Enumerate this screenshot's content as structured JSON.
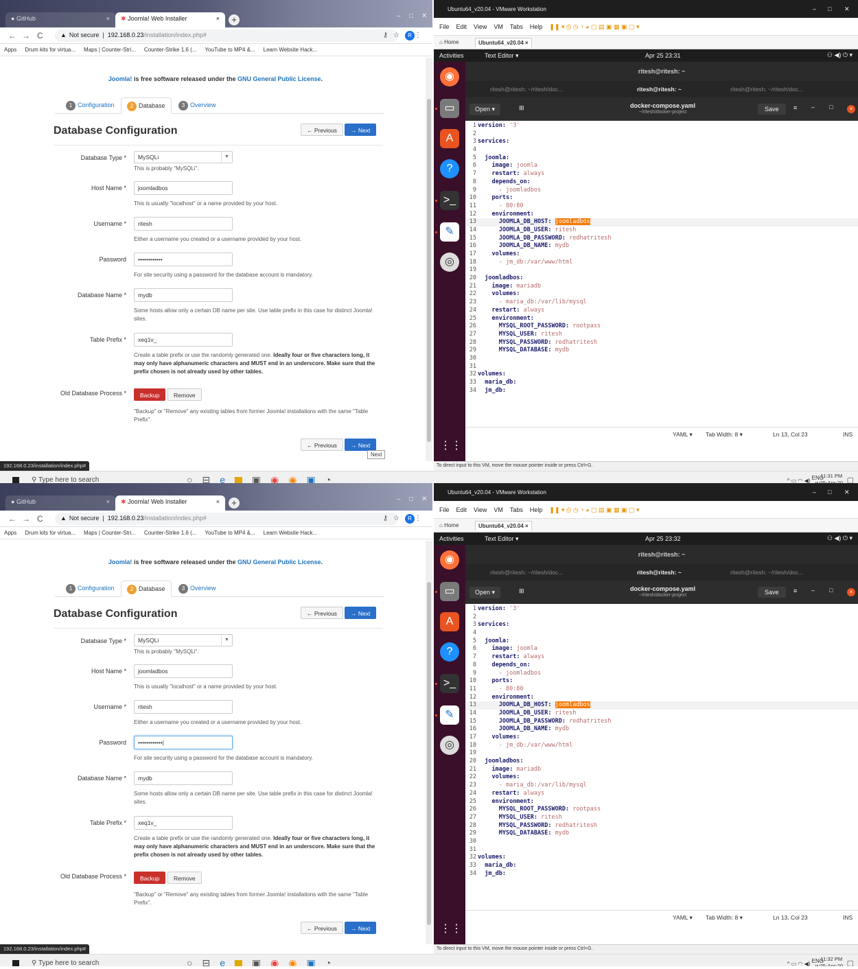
{
  "shots": [
    {
      "browser": {
        "tabs": [
          "GitHub",
          "Joomla! Web Installer"
        ],
        "security": "Not secure",
        "url_host": "192.168.0.23",
        "url_path": "/installation/index.php#",
        "bookmarks": [
          "Apps",
          "Drum kits for virtua...",
          "Maps | Counter-Stri...",
          "Counter-Strike 1.6 (...",
          "YouTube to MP4 &...",
          "Learn Website Hack..."
        ],
        "profile_initial": "R",
        "status_url": "192.168.0.23/installation/index.php#",
        "tooltip": "Next"
      },
      "joomla": {
        "license_pre": "Joomla!",
        "license_mid": " is free software released under the ",
        "license_link": "GNU General Public License",
        "license_end": ".",
        "steps": [
          {
            "n": "1",
            "label": "Configuration"
          },
          {
            "n": "2",
            "label": "Database"
          },
          {
            "n": "3",
            "label": "Overview"
          }
        ],
        "heading": "Database Configuration",
        "previous": "← Previous",
        "next": "→ Next",
        "labels": {
          "db_type": "Database Type *",
          "host": "Host Name *",
          "user": "Username *",
          "password": "Password",
          "db_name": "Database Name *",
          "prefix": "Table Prefix *",
          "old_db": "Old Database Process *"
        },
        "values": {
          "db_type": "MySQLi",
          "host": "joomladbos",
          "user": "ritesh",
          "password": "••••••••••••",
          "db_name": "mydb",
          "prefix": "xeq1v_"
        },
        "help": {
          "db_type": "This is probably \"MySQLi\".",
          "host": "This is usually \"localhost\" or a name provided by your host.",
          "user": "Either a username you created or a username provided by your host.",
          "password": "For site security using a password for the database account is mandatory.",
          "db_name": "Some hosts allow only a certain DB name per site. Use table prefix in this case for distinct Joomla! sites.",
          "prefix_a": "Create a table prefix or use the randomly generated one. ",
          "prefix_b": "Ideally four or five characters long, it may only have alphanumeric characters and MUST end in an underscore. Make sure that the prefix chosen is not already used by other tables.",
          "old_db": "\"Backup\" or \"Remove\" any existing tables from former Joomla! installations with the same \"Table Prefix\"."
        },
        "backup": "Backup",
        "remove": "Remove"
      },
      "taskbar": {
        "search": "Type here to search",
        "lang": "ENG",
        "lang2": "IN",
        "time": "11:31 PM",
        "date": "25-Apr-20"
      },
      "vm": {
        "title": "Ubuntu64_v20.04 - VMware Workstation",
        "menu": [
          "File",
          "Edit",
          "View",
          "VM",
          "Tabs",
          "Help"
        ],
        "tabs": [
          "Home",
          "Ubuntu64_v20.04"
        ],
        "activities": "Activities",
        "app": "Text Editor ▾",
        "clock": "Apr 25 23:31",
        "term_title": "ritesh@ritesh: ~",
        "term_tabs": [
          "ritesh@ritesh: ~/ritesh/doc...",
          "ritesh@ritesh: ~",
          "ritesh@ritesh: ~/ritesh/doc..."
        ],
        "open": "Open",
        "filename": "docker-compose.yaml",
        "filepath": "~/ritesh/docker-project",
        "save": "Save",
        "status_lang": "YAML ▾",
        "status_tab": "Tab Width: 8 ▾",
        "status_pos": "Ln 13, Col 23",
        "status_ins": "INS",
        "footer": "To direct input to this VM, move the mouse pointer inside or press Ctrl+G."
      }
    },
    {
      "browser": {
        "tabs": [
          "GitHub",
          "Joomla! Web Installer"
        ],
        "security": "Not secure",
        "url_host": "192.168.0.23",
        "url_path": "/installation/index.php#",
        "bookmarks": [
          "Apps",
          "Drum kits for virtua...",
          "Maps | Counter-Stri...",
          "Counter-Strike 1.6 (...",
          "YouTube to MP4 &...",
          "Learn Website Hack..."
        ],
        "profile_initial": "R",
        "status_url": "192.168.0.23/installation/index.php#",
        "tooltip": ""
      },
      "joomla": {
        "license_pre": "Joomla!",
        "license_mid": " is free software released under the ",
        "license_link": "GNU General Public License",
        "license_end": ".",
        "steps": [
          {
            "n": "1",
            "label": "Configuration"
          },
          {
            "n": "2",
            "label": "Database"
          },
          {
            "n": "3",
            "label": "Overview"
          }
        ],
        "heading": "Database Configuration",
        "previous": "← Previous",
        "next": "→ Next",
        "labels": {
          "db_type": "Database Type *",
          "host": "Host Name *",
          "user": "Username *",
          "password": "Password",
          "db_name": "Database Name *",
          "prefix": "Table Prefix *",
          "old_db": "Old Database Process *"
        },
        "values": {
          "db_type": "MySQLi",
          "host": "joomladbos",
          "user": "ritesh",
          "password": "••••••••••••|",
          "db_name": "mydb",
          "prefix": "xeq1v_"
        },
        "help": {
          "db_type": "This is probably \"MySQLi\".",
          "host": "This is usually \"localhost\" or a name provided by your host.",
          "user": "Either a username you created or a username provided by your host.",
          "password": "For site security using a password for the database account is mandatory.",
          "db_name": "Some hosts allow only a certain DB name per site. Use table prefix in this case for distinct Joomla! sites.",
          "prefix_a": "Create a table prefix or use the randomly generated one. ",
          "prefix_b": "Ideally four or five characters long, it may only have alphanumeric characters and MUST end in an underscore. Make sure that the prefix chosen is not already used by other tables.",
          "old_db": "\"Backup\" or \"Remove\" any existing tables from former Joomla! installations with the same \"Table Prefix\"."
        },
        "backup": "Backup",
        "remove": "Remove"
      },
      "taskbar": {
        "search": "Type here to search",
        "lang": "ENG",
        "lang2": "IN",
        "time": "11:32 PM",
        "date": "25-Apr-20"
      },
      "vm": {
        "title": "Ubuntu64_v20.04 - VMware Workstation",
        "menu": [
          "File",
          "Edit",
          "View",
          "VM",
          "Tabs",
          "Help"
        ],
        "tabs": [
          "Home",
          "Ubuntu64_v20.04"
        ],
        "activities": "Activities",
        "app": "Text Editor ▾",
        "clock": "Apr 25 23:32",
        "term_title": "ritesh@ritesh: ~",
        "term_tabs": [
          "ritesh@ritesh: ~/ritesh/doc...",
          "ritesh@ritesh: ~",
          "ritesh@ritesh: ~/ritesh/doc..."
        ],
        "open": "Open",
        "filename": "docker-compose.yaml",
        "filepath": "~/ritesh/docker-project",
        "save": "Save",
        "status_lang": "YAML ▾",
        "status_tab": "Tab Width: 8 ▾",
        "status_pos": "Ln 13, Col 23",
        "status_ins": "INS",
        "footer": "To direct input to this VM, move the mouse pointer inside or press Ctrl+G."
      }
    }
  ],
  "code_lines": [
    {
      "n": "1",
      "key": "version:",
      "val": " '3'",
      "indent": ""
    },
    {
      "n": "2",
      "key": "",
      "val": "",
      "indent": ""
    },
    {
      "n": "3",
      "key": "services:",
      "val": "",
      "indent": ""
    },
    {
      "n": "4",
      "key": "",
      "val": "",
      "indent": ""
    },
    {
      "n": "5",
      "key": "joomla:",
      "val": "",
      "indent": "  "
    },
    {
      "n": "6",
      "key": "image:",
      "val": " joomla",
      "indent": "    "
    },
    {
      "n": "7",
      "key": "restart:",
      "val": " always",
      "indent": "    "
    },
    {
      "n": "8",
      "key": "depends_on:",
      "val": "",
      "indent": "    "
    },
    {
      "n": "9",
      "key": "",
      "val": "- joomladbos",
      "indent": "      "
    },
    {
      "n": "10",
      "key": "ports:",
      "val": "",
      "indent": "    "
    },
    {
      "n": "11",
      "key": "",
      "val": "- 80:80",
      "indent": "      "
    },
    {
      "n": "12",
      "key": "environment:",
      "val": "",
      "indent": "    "
    },
    {
      "n": "13",
      "key": "JOOMLA_DB_HOST:",
      "val": "",
      "hl": "joomladbos",
      "indent": "      "
    },
    {
      "n": "14",
      "key": "JOOMLA_DB_USER:",
      "val": " ritesh",
      "indent": "      "
    },
    {
      "n": "15",
      "key": "JOOMLA_DB_PASSWORD:",
      "val": " redhatritesh",
      "indent": "      "
    },
    {
      "n": "16",
      "key": "JOOMLA_DB_NAME:",
      "val": " mydb",
      "indent": "      "
    },
    {
      "n": "17",
      "key": "volumes:",
      "val": "",
      "indent": "    "
    },
    {
      "n": "18",
      "key": "",
      "val": "- jm_db:/var/www/html",
      "indent": "      "
    },
    {
      "n": "19",
      "key": "",
      "val": "",
      "indent": ""
    },
    {
      "n": "20",
      "key": "joomladbos:",
      "val": "",
      "indent": "  "
    },
    {
      "n": "21",
      "key": "image:",
      "val": " mariadb",
      "indent": "    "
    },
    {
      "n": "22",
      "key": "volumes:",
      "val": "",
      "indent": "    "
    },
    {
      "n": "23",
      "key": "",
      "val": "- maria_db:/var/lib/mysql",
      "indent": "      "
    },
    {
      "n": "24",
      "key": "restart:",
      "val": " always",
      "indent": "    "
    },
    {
      "n": "25",
      "key": "environment:",
      "val": "",
      "indent": "    "
    },
    {
      "n": "26",
      "key": "MYSQL_ROOT_PASSWORD:",
      "val": " rootpass",
      "indent": "      "
    },
    {
      "n": "27",
      "key": "MYSQL_USER:",
      "val": " ritesh",
      "indent": "      "
    },
    {
      "n": "28",
      "key": "MYSQL_PASSWORD:",
      "val": " redhatritesh",
      "indent": "      "
    },
    {
      "n": "29",
      "key": "MYSQL_DATABASE:",
      "val": " mydb",
      "indent": "      "
    },
    {
      "n": "30",
      "key": "",
      "val": "",
      "indent": ""
    },
    {
      "n": "31",
      "key": "",
      "val": "",
      "indent": ""
    },
    {
      "n": "32",
      "key": "volumes:",
      "val": "",
      "indent": ""
    },
    {
      "n": "33",
      "key": "maria_db:",
      "val": "",
      "indent": "  "
    },
    {
      "n": "34",
      "key": "jm_db:",
      "val": "",
      "indent": "  "
    }
  ],
  "colors": {
    "joomla_blue": "#1e73be",
    "primary": "#2a6fc9",
    "danger": "#c9302c",
    "ubuntu_dock": "#3a0f2a",
    "ubuntu_orange": "#e95420"
  },
  "icons": {
    "dock": [
      "firefox-icon",
      "files-icon",
      "software-icon",
      "help-icon",
      "terminal-icon",
      "text-editor-icon",
      "dvd-icon",
      "app-grid-icon"
    ]
  }
}
